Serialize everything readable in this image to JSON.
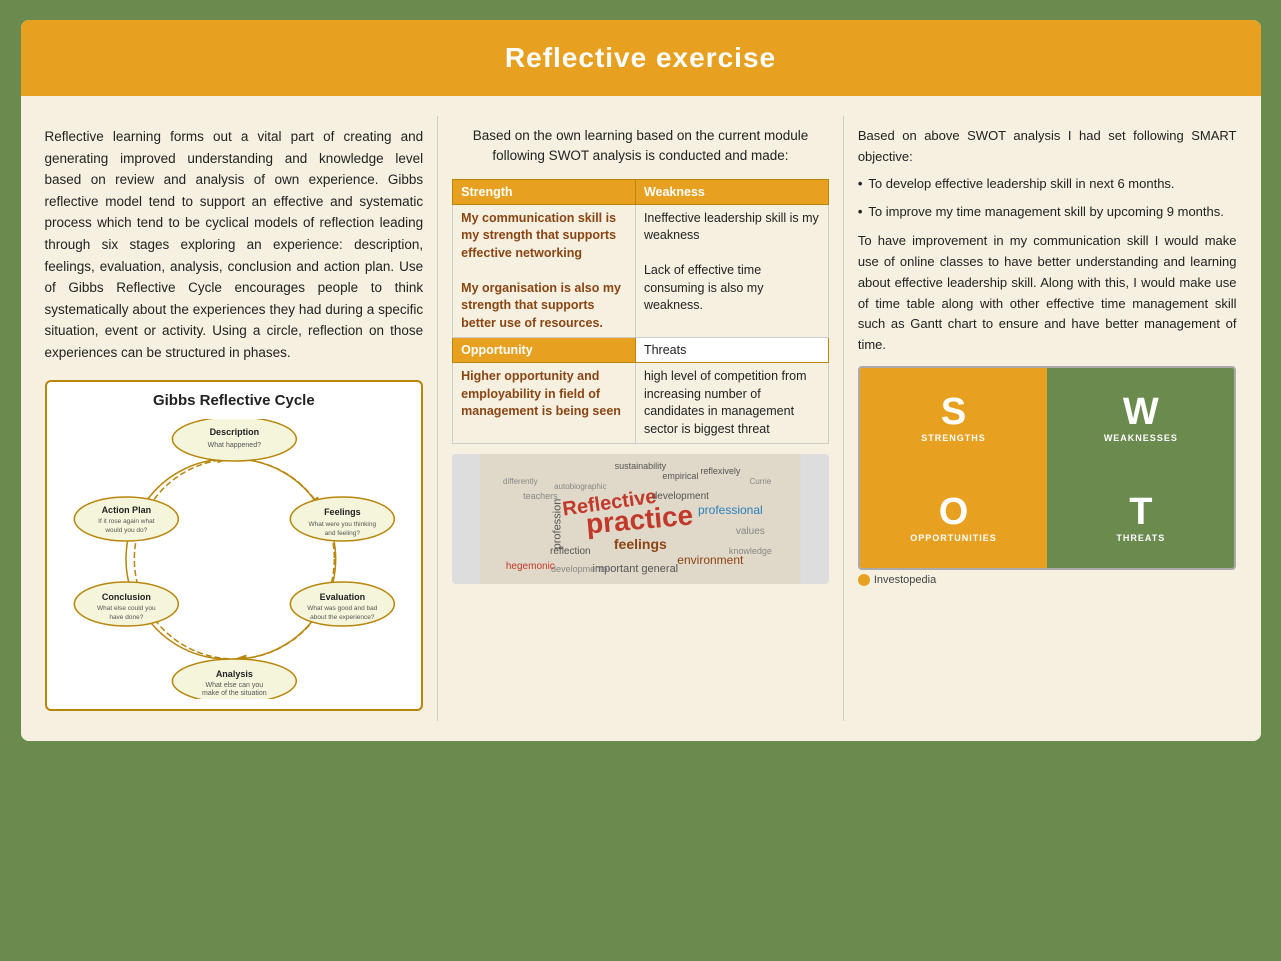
{
  "header": {
    "title": "Reflective exercise"
  },
  "left_col": {
    "paragraph1": "Reflective learning forms out a vital part of creating and generating improved understanding and knowledge level based on review and analysis of own experience. Gibbs reflective model tend to support an effective and systematic process which tend to be cyclical models of reflection leading through six stages exploring an experience: description, feelings, evaluation, analysis, conclusion and action plan. Use of Gibbs Reflective Cycle encourages people to think systematically about the experiences they had during a specific situation, event or activity. Using a circle, reflection on those experiences can be structured in phases.",
    "gibbs_title": "Gibbs Reflective Cycle",
    "nodes": [
      {
        "id": "description",
        "label": "Description",
        "sub": "What happened?"
      },
      {
        "id": "feelings",
        "label": "Feelings",
        "sub": "What were you thinking and feeling?"
      },
      {
        "id": "evaluation",
        "label": "Evaluation",
        "sub": "What was good and bad about the experience?"
      },
      {
        "id": "analysis",
        "label": "Analysis",
        "sub": "What else can you make of the situation"
      },
      {
        "id": "conclusion",
        "label": "Conclusion",
        "sub": "What else could you have done?"
      },
      {
        "id": "action_plan",
        "label": "Action Plan",
        "sub": "If it rose again what would you do?"
      }
    ]
  },
  "middle_col": {
    "intro": "Based on the own learning based on the current module following SWOT analysis is conducted and made:",
    "swot_headers": [
      "Strength",
      "Weakness"
    ],
    "swot_strength": "My communication skill is my strength that supports effective networking\nMy organisation is also my strength that supports better use of resources.",
    "swot_weakness": "Ineffective leadership skill is my weakness\nLack of effective time consuming is also my weakness.",
    "opp_header": "Opportunity",
    "threats_header": "Threats",
    "opportunity": "Higher opportunity and employability in field of management is being seen",
    "threats": "high level of competition from increasing number of candidates in management sector is biggest threat"
  },
  "right_col": {
    "intro": "Based on above SWOT analysis I had set following SMART objective:",
    "bullets": [
      "To develop effective leadership skill in next 6 months.",
      "To improve my time management skill by upcoming 9 months."
    ],
    "paragraph": "To have improvement in my communication skill I would make use of online classes to have better understanding and learning about effective leadership skill. Along with this, I would make use of time table along with other effective time management skill such as Gantt chart to ensure and have better management of time.",
    "swot_cells": [
      {
        "letter": "S",
        "label": "STRENGTHS",
        "class": "s"
      },
      {
        "letter": "W",
        "label": "WEAKNESSES",
        "class": "w"
      },
      {
        "letter": "O",
        "label": "OPPORTUNITIES",
        "class": "o"
      },
      {
        "letter": "T",
        "label": "THREATS",
        "class": "t"
      }
    ],
    "investopedia": "Investopedia"
  }
}
